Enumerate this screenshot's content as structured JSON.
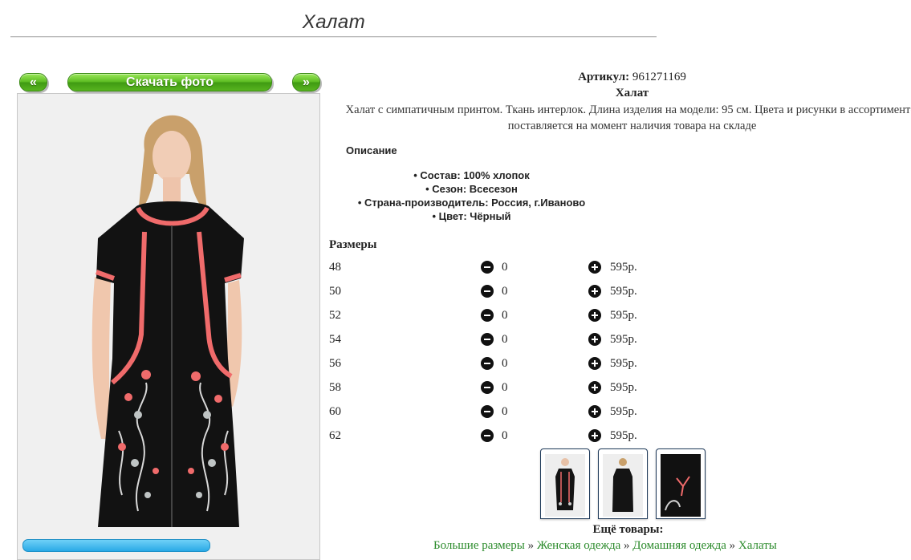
{
  "header": {
    "title": "Халат"
  },
  "gallery": {
    "prev_label": "«",
    "download_label": "Скачать фото",
    "next_label": "»"
  },
  "product": {
    "article_label": "Артикул:",
    "article_value": "961271169",
    "name": "Халат",
    "description": "Халат с симпатичным принтом. Ткань интерлок. Длина изделия на модели: 95 см. Цвета и рисунки в ассортименте, поставляется на момент наличия товара на складе",
    "description_heading": "Описание",
    "specs": [
      "Состав: 100% хлопок",
      "Сезон: Всесезон",
      "Страна-производитель: Россия, г.Иваново",
      "Цвет: Чёрный"
    ]
  },
  "sizes": {
    "heading": "Размеры",
    "rows": [
      {
        "size": "48",
        "qty": "0",
        "price": "595р."
      },
      {
        "size": "50",
        "qty": "0",
        "price": "595р."
      },
      {
        "size": "52",
        "qty": "0",
        "price": "595р."
      },
      {
        "size": "54",
        "qty": "0",
        "price": "595р."
      },
      {
        "size": "56",
        "qty": "0",
        "price": "595р."
      },
      {
        "size": "58",
        "qty": "0",
        "price": "595р."
      },
      {
        "size": "60",
        "qty": "0",
        "price": "595р."
      },
      {
        "size": "62",
        "qty": "0",
        "price": "595р."
      }
    ]
  },
  "more": {
    "heading": "Ещё товары:",
    "crumbs": [
      "Большие размеры",
      "Женская одежда",
      "Домашняя одежда",
      "Халаты"
    ],
    "separator": "»"
  },
  "colors": {
    "accent_green": "#5cbc22",
    "dress_black": "#121212",
    "trim_coral": "#f06b6b",
    "link_green": "#2a8a2a"
  }
}
